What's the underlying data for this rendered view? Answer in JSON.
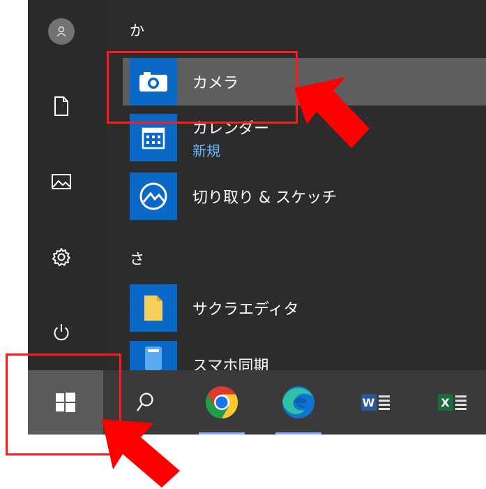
{
  "start_menu": {
    "section_ka": "か",
    "section_sa": "さ",
    "apps": [
      {
        "name": "カメラ",
        "sub": ""
      },
      {
        "name": "カレンダー",
        "sub": "新規"
      },
      {
        "name": "切り取り & スケッチ",
        "sub": ""
      },
      {
        "name": "サクラエディタ",
        "sub": ""
      },
      {
        "name": "スマホ同期",
        "sub": ""
      }
    ]
  },
  "rail_icons": [
    "user-icon",
    "document-icon",
    "pictures-icon",
    "settings-icon",
    "power-icon"
  ],
  "taskbar_icons": [
    "windows-start-icon",
    "search-icon",
    "chrome-icon",
    "edge-icon",
    "word-icon",
    "excel-icon"
  ],
  "word_letter": "W",
  "excel_letter": "X",
  "colors": {
    "accent_tile": "#0a68c6",
    "highlight": "#ff1a1a",
    "new_badge": "#6cb6ff"
  }
}
